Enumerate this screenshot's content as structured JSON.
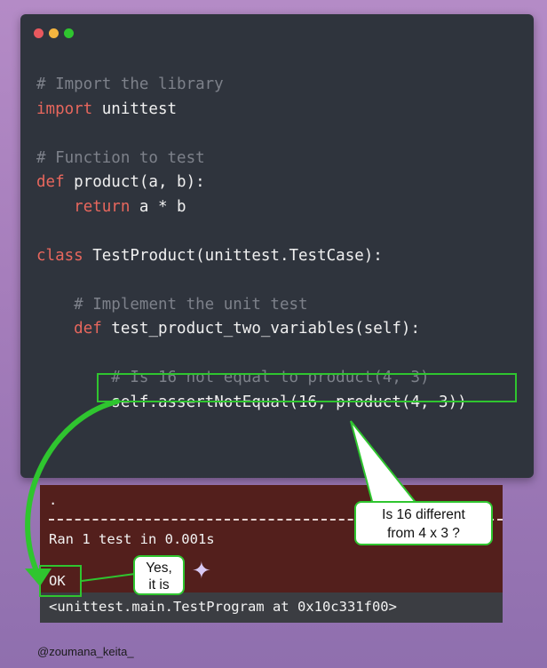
{
  "window": {
    "dots": [
      {
        "name": "close",
        "color": "#e8585e"
      },
      {
        "name": "minimize",
        "color": "#f4b53f"
      },
      {
        "name": "maximize",
        "color": "#2fc52f"
      }
    ]
  },
  "code": {
    "lines": [
      {
        "indent": "",
        "parts": [
          {
            "t": "# Import the library",
            "c": "cmt"
          }
        ]
      },
      {
        "indent": "",
        "parts": [
          {
            "t": "import",
            "c": "kw"
          },
          {
            "t": " unittest",
            "c": "fn"
          }
        ]
      },
      {
        "indent": "",
        "parts": []
      },
      {
        "indent": "",
        "parts": [
          {
            "t": "# Function to test",
            "c": "cmt"
          }
        ]
      },
      {
        "indent": "",
        "parts": [
          {
            "t": "def",
            "c": "kw"
          },
          {
            "t": " product(a, b):",
            "c": "fn"
          }
        ]
      },
      {
        "indent": "    ",
        "parts": [
          {
            "t": "return",
            "c": "kw"
          },
          {
            "t": " a * b",
            "c": "fn"
          }
        ]
      },
      {
        "indent": "",
        "parts": []
      },
      {
        "indent": "",
        "parts": [
          {
            "t": "class",
            "c": "kw"
          },
          {
            "t": " TestProduct(unittest.TestCase):",
            "c": "fn"
          }
        ]
      },
      {
        "indent": "",
        "parts": []
      },
      {
        "indent": "    ",
        "parts": [
          {
            "t": "# Implement the unit test",
            "c": "cmt"
          }
        ]
      },
      {
        "indent": "    ",
        "parts": [
          {
            "t": "def",
            "c": "kw"
          },
          {
            "t": " test_product_two_variables(self):",
            "c": "fn"
          }
        ]
      },
      {
        "indent": "",
        "parts": []
      },
      {
        "indent": "        ",
        "parts": [
          {
            "t": "# Is 16 not equal to product(4, 3)",
            "c": "cmt"
          }
        ]
      },
      {
        "indent": "        ",
        "parts": [
          {
            "t": "self.assertNotEqual(16, product(4, 3))",
            "c": "fn"
          }
        ]
      }
    ]
  },
  "terminal": {
    "dot_line": ".",
    "ran_line": "Ran 1 test in 0.001s",
    "ok_line": "OK",
    "program_line": "<unittest.main.TestProgram at 0x10c331f00>"
  },
  "callouts": {
    "question_line1": "Is 16 different",
    "question_line2": "from 4 x 3 ?",
    "answer_line1": "Yes,",
    "answer_line2": "it is"
  },
  "footer": {
    "handle": "@zoumana_keita_"
  },
  "colors": {
    "accent_green": "#2fc52f",
    "editor_bg": "#2f343d",
    "terminal_bg": "#531f1c"
  }
}
